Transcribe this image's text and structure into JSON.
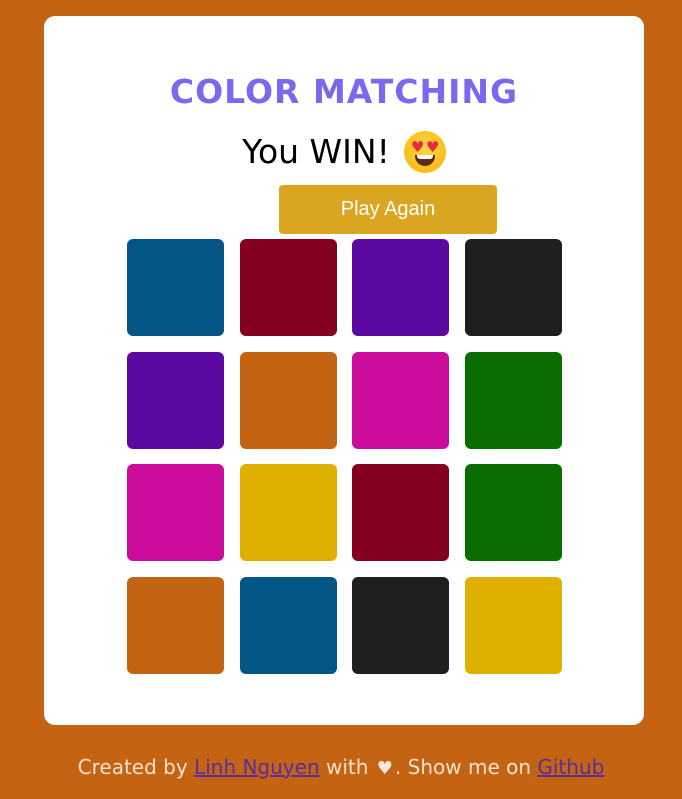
{
  "title": "COLOR MATCHING",
  "status": {
    "text": "You WIN!",
    "emoji": "heart-eyes-face-icon"
  },
  "play_button": {
    "label": "Play Again"
  },
  "tiles": [
    {
      "color": "#025584"
    },
    {
      "color": "#84001f"
    },
    {
      "color": "#5a0aa0"
    },
    {
      "color": "#1f1f1f"
    },
    {
      "color": "#5a0aa0"
    },
    {
      "color": "#c46412"
    },
    {
      "color": "#cc0c9c"
    },
    {
      "color": "#086c00"
    },
    {
      "color": "#cc0c9c"
    },
    {
      "color": "#e0b000"
    },
    {
      "color": "#84001f"
    },
    {
      "color": "#086c00"
    },
    {
      "color": "#c46412"
    },
    {
      "color": "#025584"
    },
    {
      "color": "#1f1f1f"
    },
    {
      "color": "#e0b000"
    }
  ],
  "footer": {
    "prefix": "Created by",
    "author": "Linh Nguyen",
    "middle": "with",
    "heart": "♥",
    "suffix": ". Show me on",
    "link": "Github"
  },
  "colors": {
    "page_background": "#c46412",
    "card_background": "#ffffff",
    "title": "#7b68ee",
    "button": "#daa520",
    "link": "#5a2d9e"
  }
}
